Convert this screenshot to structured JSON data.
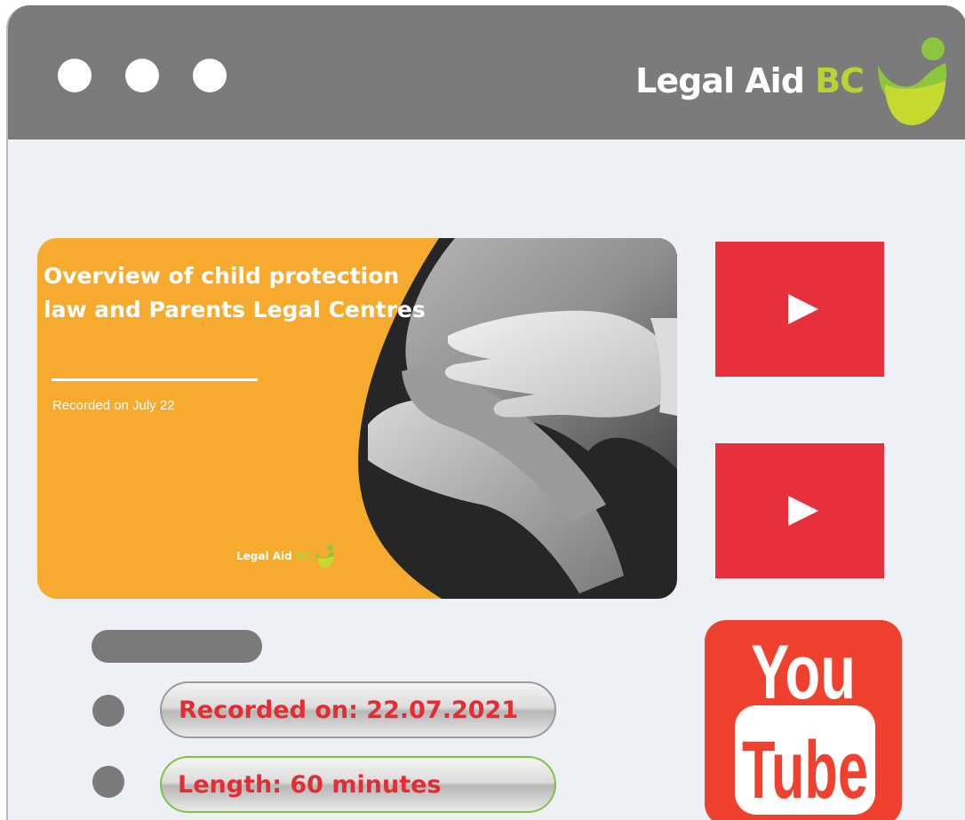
{
  "header": {
    "brand_name": "Legal Aid",
    "brand_accent": "BC",
    "window_controls": [
      "dot",
      "dot",
      "dot"
    ],
    "logo_icon": "legal-aid-bc-logo-icon"
  },
  "video": {
    "title_line1": "Overview of child protection",
    "title_line2": "law and Parents Legal Centres",
    "subtitle": "Recorded on July 22",
    "logo_name": "Legal Aid",
    "logo_accent": "BC",
    "photo": "hands-holding-baby-hand-photo"
  },
  "sidebar": {
    "play_buttons": [
      "play-icon",
      "play-icon"
    ],
    "youtube_logo_top": "You",
    "youtube_logo_bottom": "Tube"
  },
  "details": {
    "recorded": "Recorded on: 22.07.2021",
    "length": "Length:  60 minutes"
  },
  "colors": {
    "titlebar": "#7b7b7b",
    "window_bg": "#edf0f4",
    "slide_orange": "#f6ab2f",
    "play_red": "#e8303d",
    "youtube_red": "#f0412f",
    "brand_green": "#b8d432",
    "text_red": "#e32d32"
  }
}
